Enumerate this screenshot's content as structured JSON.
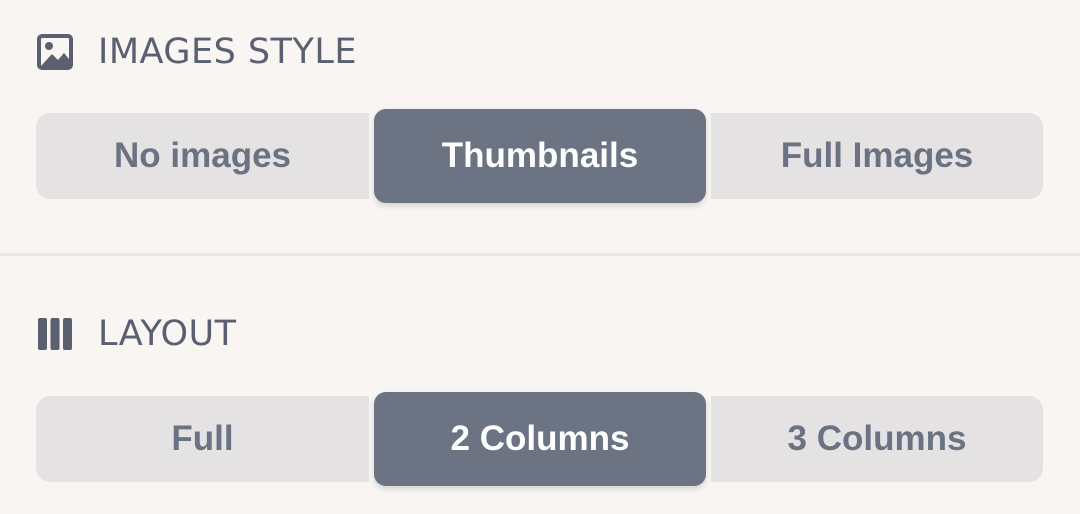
{
  "colors": {
    "background": "#f8f5f2",
    "segment_bg": "#e4e2e3",
    "segment_selected_bg": "#6c7484",
    "segment_text": "#6b7382",
    "segment_selected_text": "#ffffff",
    "header_text": "#5a6070"
  },
  "images_style": {
    "title": "IMAGES STYLE",
    "icon": "image-icon",
    "options": [
      "No images",
      "Thumbnails",
      "Full Images"
    ],
    "selected": "Thumbnails"
  },
  "layout": {
    "title": "LAYOUT",
    "icon": "columns-icon",
    "options": [
      "Full",
      "2 Columns",
      "3 Columns"
    ],
    "selected": "2 Columns"
  }
}
